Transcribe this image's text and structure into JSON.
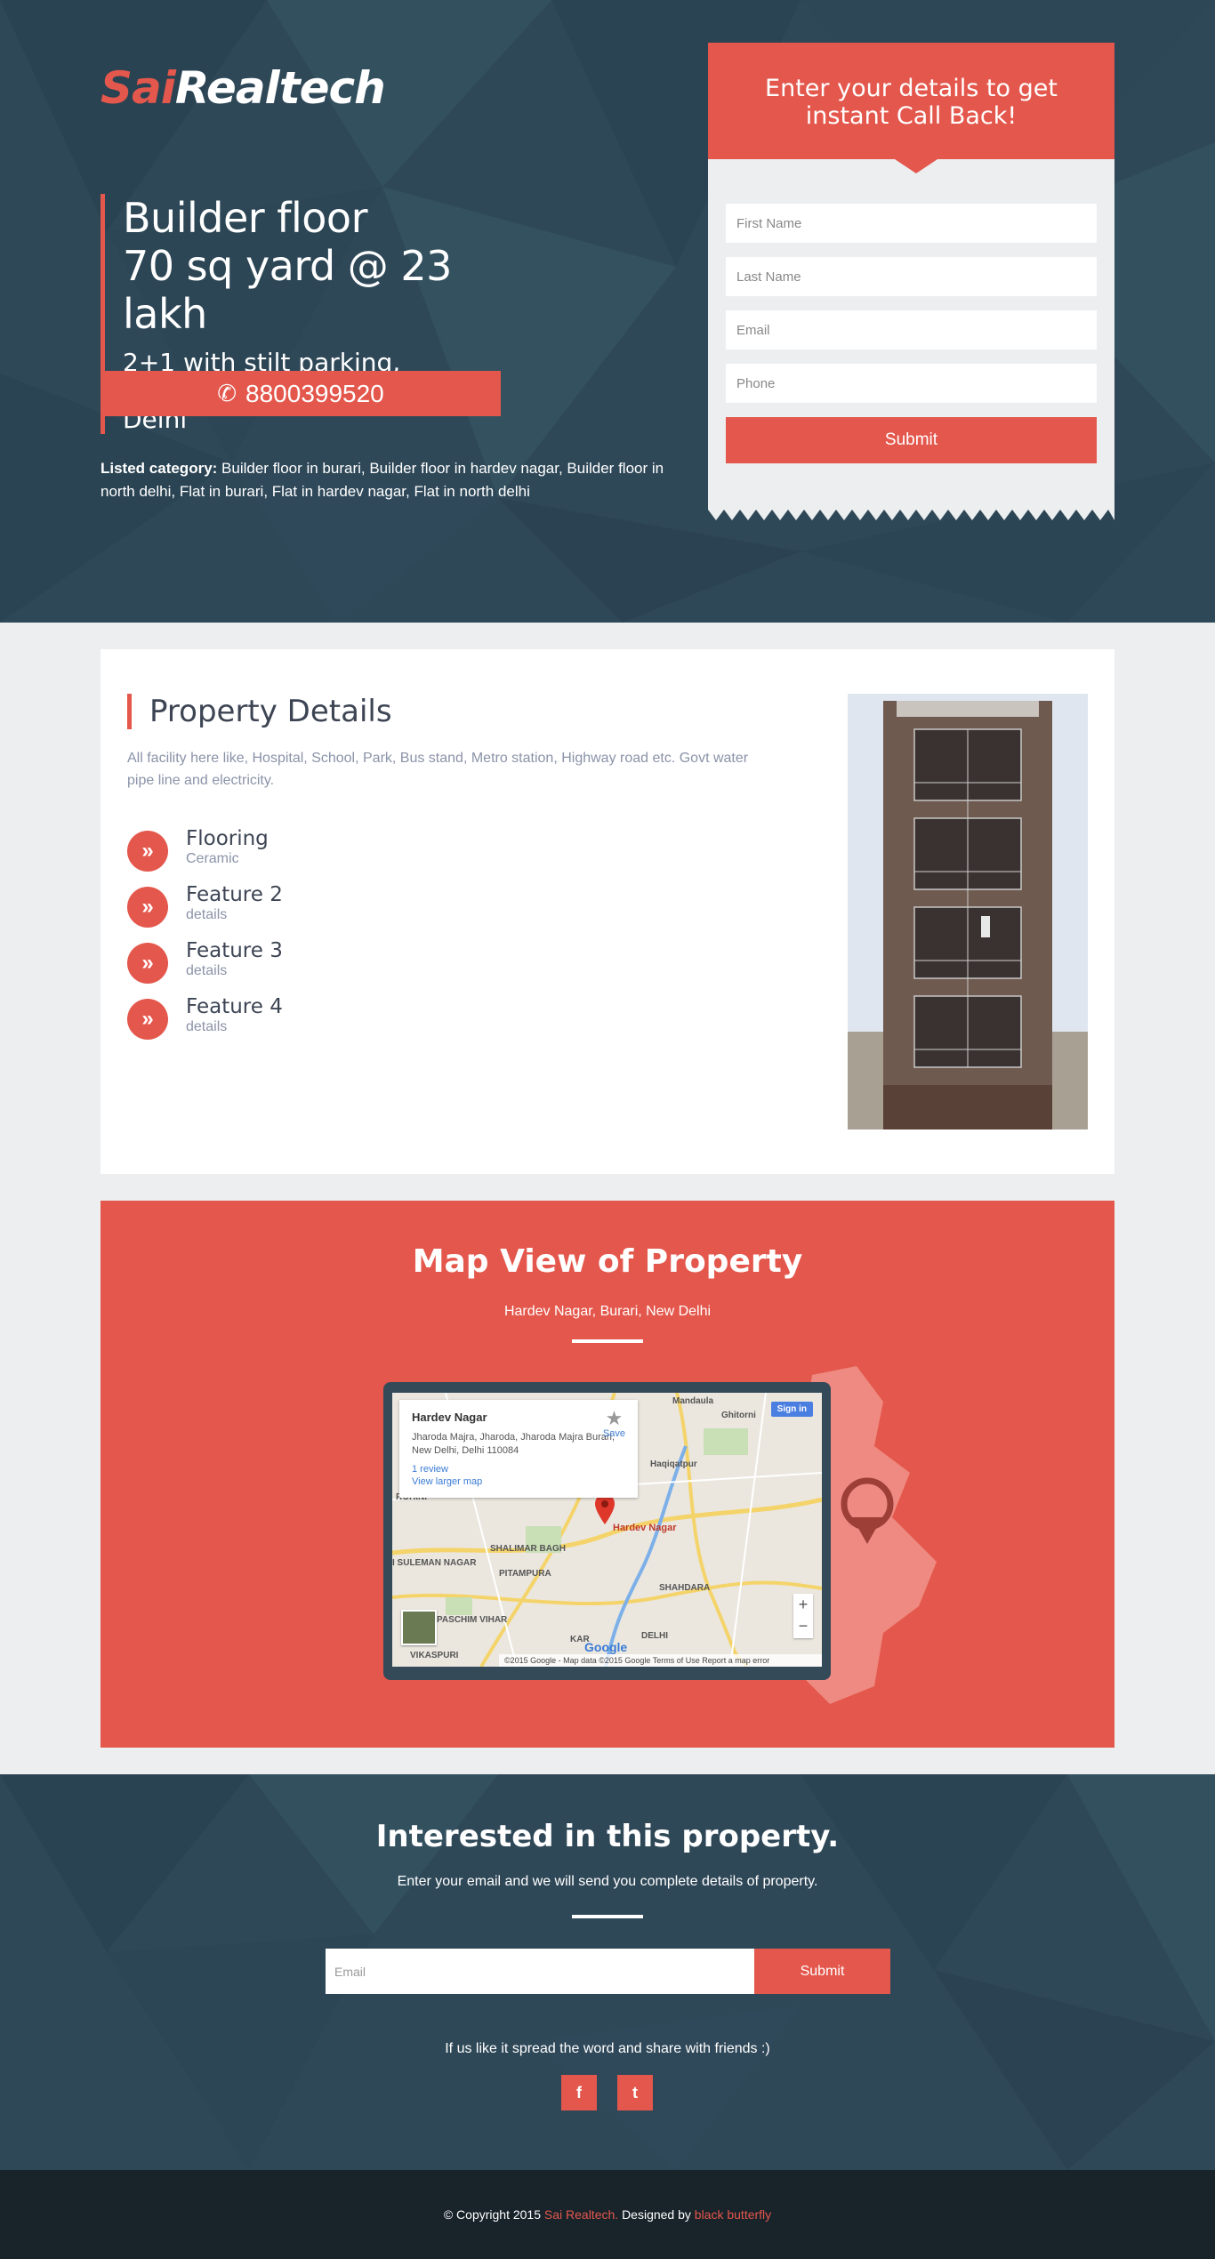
{
  "brand": {
    "name_accent": "Sai",
    "name_rest": "Realtech"
  },
  "hero": {
    "headline_line1": "Builder floor",
    "headline_line2": "70 sq yard @ 23 lakh",
    "subline_line1": "2+1 with stilt parking,",
    "subline_line2": "Hardev Nagar, Burari, New Delhi",
    "phone": "8800399520",
    "phone_icon": "phone-icon",
    "listed_label": "Listed category:",
    "listed_text": "Builder floor in burari, Builder floor in hardev nagar, Builder floor in north delhi, Flat in burari, Flat in hardev nagar, Flat in north delhi"
  },
  "callback_form": {
    "heading": "Enter your details to get instant Call Back!",
    "first_name_placeholder": "First Name",
    "last_name_placeholder": "Last Name",
    "email_placeholder": "Email",
    "phone_placeholder": "Phone",
    "submit_label": "Submit"
  },
  "details": {
    "title": "Property Details",
    "description": "All facility here like, Hospital, School, Park, Bus stand, Metro station, Highway road etc. Govt water pipe line and electricity.",
    "features": [
      {
        "title": "Flooring",
        "sub": "Ceramic"
      },
      {
        "title": "Feature 2",
        "sub": "details"
      },
      {
        "title": "Feature 3",
        "sub": "details"
      },
      {
        "title": "Feature 4",
        "sub": "details"
      }
    ],
    "bullet_glyph": "»"
  },
  "map": {
    "title": "Map View of Property",
    "subtitle": "Hardev Nagar, Burari, New Delhi",
    "info_title": "Hardev Nagar",
    "info_address": "Jharoda Majra, Jharoda, Jharoda Majra Burari, New Delhi, Delhi 110084",
    "info_reviews": "1 review",
    "info_larger": "View larger map",
    "save_label": "Save",
    "signin_label": "Sign in",
    "pin_label": "Hardev Nagar",
    "labels": {
      "mandaula": "Mandaula",
      "ghitorni": "Ghitorni",
      "haqiqatpur": "Haqiqatpur",
      "rohini": "ROHINI",
      "shalimar": "SHALIMAR BAGH",
      "pitampura": "PITAMPURA",
      "sulemann": "I SULEMAN NAGAR",
      "shahdara": "SHAHDARA",
      "paschim": "PASCHIM VIHAR",
      "vikaspuri": "VIKASPURI",
      "karol": "KAR",
      "delhi": "DELHI"
    },
    "footer_text": "©2015 Google - Map data ©2015 Google   Terms of Use   Report a map error",
    "google": "Google",
    "zoom_in": "+",
    "zoom_out": "−"
  },
  "interest": {
    "title": "Interested in this property.",
    "subtitle": "Enter your email and we will send you complete details of property.",
    "email_placeholder": "Email",
    "submit_label": "Submit",
    "share_text": "If us like it spread the word and share with friends :)",
    "facebook_glyph": "f",
    "twitter_glyph": "t"
  },
  "footer": {
    "copyright": "© Copyright 2015",
    "company": "Sai Realtech.",
    "designed_by": "Designed by",
    "designer": "black butterfly"
  },
  "colors": {
    "accent": "#e4574c",
    "dark": "#2f4858",
    "footer": "#18232a"
  }
}
